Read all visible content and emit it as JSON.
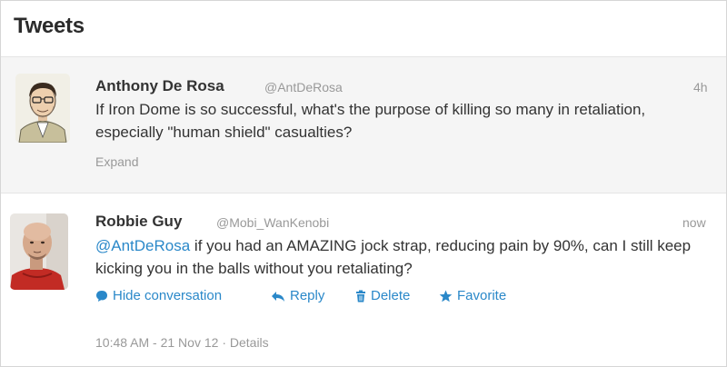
{
  "header": {
    "title": "Tweets"
  },
  "tweets": [
    {
      "name": "Anthony De Rosa",
      "handle": "@AntDeRosa",
      "time": "4h",
      "text": "If Iron Dome is so successful, what's the purpose of killing so many in retaliation, especially \"human shield\" casualties?",
      "expand": "Expand"
    },
    {
      "name": "Robbie Guy",
      "handle": "@Mobi_WanKenobi",
      "time": "now",
      "mention": "@AntDeRosa",
      "text": " if you had an AMAZING jock strap, reducing pain by 90%, can I still keep kicking you in the balls without you retaliating?",
      "actions": {
        "hide": "Hide conversation",
        "reply": "Reply",
        "delete": "Delete",
        "favorite": "Favorite"
      },
      "timestamp": "10:48 AM - 21 Nov 12",
      "separator": "·",
      "details": "Details"
    }
  ],
  "colors": {
    "link": "#2a88c9",
    "muted": "#999999",
    "selected_bg": "#f5f5f5"
  },
  "icons": [
    "speech-bubble-icon",
    "reply-arrow-icon",
    "trash-icon",
    "star-icon"
  ]
}
